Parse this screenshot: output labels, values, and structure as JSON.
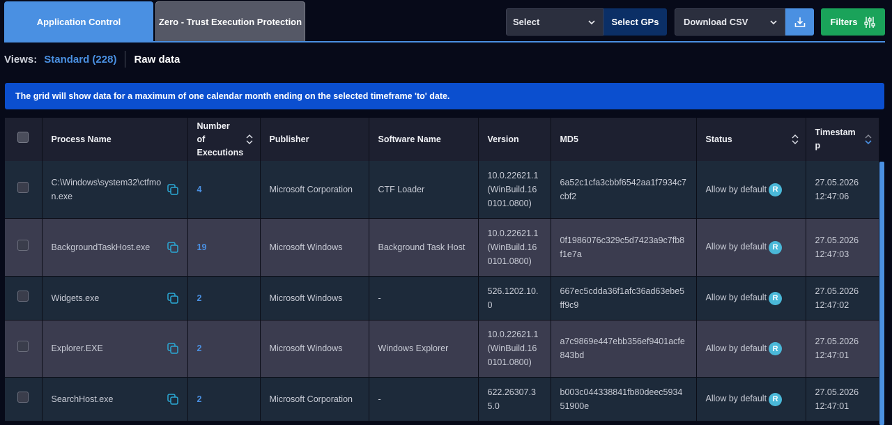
{
  "tabs": [
    {
      "label": "Application Control",
      "active": true
    },
    {
      "label": "Zero - Trust Execution Protection",
      "active": false
    }
  ],
  "toolbar": {
    "select_label": "Select",
    "select_gps_label": "Select GPs",
    "download_label": "Download CSV",
    "filters_label": "Filters"
  },
  "views": {
    "label": "Views:",
    "standard": "Standard (228)",
    "raw": "Raw data"
  },
  "banner": "The grid will show data for a maximum of one calendar month ending on the selected timeframe 'to' date.",
  "columns": {
    "process": "Process Name",
    "executions": "Number of Executions",
    "publisher": "Publisher",
    "software": "Software Name",
    "version": "Version",
    "md5": "MD5",
    "status": "Status",
    "timestamp": "Timestamp"
  },
  "rows": [
    {
      "process": "C:\\Windows\\system32\\ctfmon.exe",
      "executions": "4",
      "publisher": "Microsoft Corporation",
      "software": "CTF Loader",
      "version": "10.0.22621.1 (WinBuild.160101.0800)",
      "md5": "6a52c1cfa3cbbf6542aa1f7934c7cbf2",
      "status": "Allow by default",
      "badge": "R",
      "date": "27.05.2026",
      "time": "12:47:06"
    },
    {
      "process": "BackgroundTaskHost.exe",
      "executions": "19",
      "publisher": "Microsoft Windows",
      "software": "Background Task Host",
      "version": "10.0.22621.1 (WinBuild.160101.0800)",
      "md5": "0f1986076c329c5d7423a9c7fb8f1e7a",
      "status": "Allow by default",
      "badge": "R",
      "date": "27.05.2026",
      "time": "12:47:03"
    },
    {
      "process": "Widgets.exe",
      "executions": "2",
      "publisher": "Microsoft Windows",
      "software": "-",
      "version": "526.1202.10.0",
      "md5": "667ec5cdda36f1afc36ad63ebe5ff9c9",
      "status": "Allow by default",
      "badge": "R",
      "date": "27.05.2026",
      "time": "12:47:02"
    },
    {
      "process": "Explorer.EXE",
      "executions": "2",
      "publisher": "Microsoft Windows",
      "software": "Windows Explorer",
      "version": "10.0.22621.1 (WinBuild.160101.0800)",
      "md5": "a7c9869e447ebb356ef9401acfe843bd",
      "status": "Allow by default",
      "badge": "R",
      "date": "27.05.2026",
      "time": "12:47:01"
    },
    {
      "process": "SearchHost.exe",
      "executions": "2",
      "publisher": "Microsoft Corporation",
      "software": "-",
      "version": "622.26307.35.0",
      "md5": "b003c044338841fb80deec593451900e",
      "status": "Allow by default",
      "badge": "R",
      "date": "27.05.2026",
      "time": "12:47:01"
    }
  ],
  "colors": {
    "accent": "#4a90e2",
    "banner": "#0b4fcf",
    "filters": "#1aa35a",
    "badge": "#4ab8d8"
  }
}
